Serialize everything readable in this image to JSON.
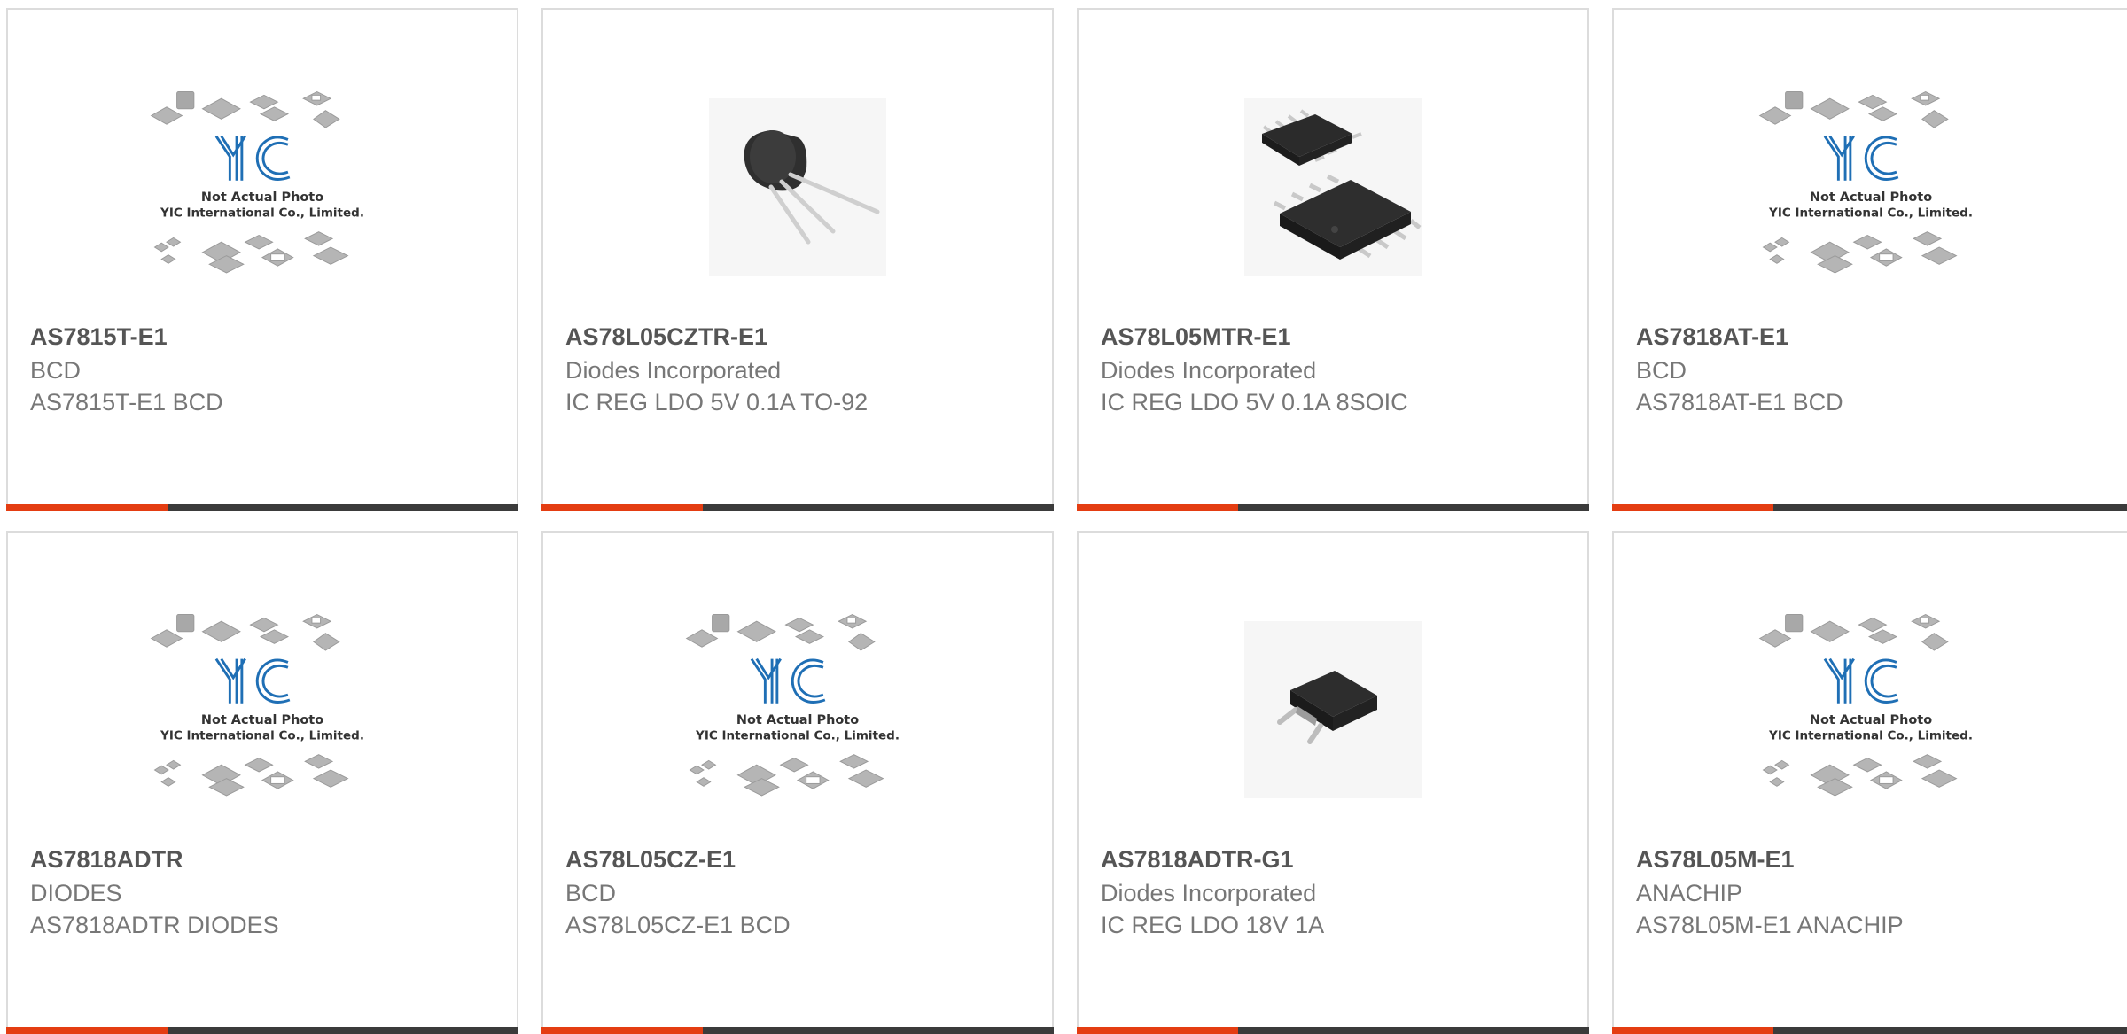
{
  "placeholder": {
    "line1": "Not Actual Photo",
    "line2": "YIC International Co., Limited.",
    "logo_text": "YIC",
    "logo_color": "#1f6fb5"
  },
  "colors": {
    "accent": "#e43d12",
    "bar": "#3b3b3b",
    "border": "#dcdcdc"
  },
  "products": [
    {
      "part": "AS7815T-E1",
      "manufacturer": "BCD",
      "description": "AS7815T-E1 BCD",
      "image": "placeholder-logo"
    },
    {
      "part": "AS78L05CZTR-E1",
      "manufacturer": "Diodes Incorporated",
      "description": "IC REG LDO 5V 0.1A TO-92",
      "image": "to92-package"
    },
    {
      "part": "AS78L05MTR-E1",
      "manufacturer": "Diodes Incorporated",
      "description": "IC REG LDO 5V 0.1A 8SOIC",
      "image": "soic8-package"
    },
    {
      "part": "AS7818AT-E1",
      "manufacturer": "BCD",
      "description": "AS7818AT-E1 BCD",
      "image": "placeholder-logo"
    },
    {
      "part": "AS7818ADTR",
      "manufacturer": "DIODES",
      "description": "AS7818ADTR DIODES",
      "image": "placeholder-logo"
    },
    {
      "part": "AS78L05CZ-E1",
      "manufacturer": "BCD",
      "description": "AS78L05CZ-E1 BCD",
      "image": "placeholder-logo"
    },
    {
      "part": "AS7818ADTR-G1",
      "manufacturer": "Diodes Incorporated",
      "description": "IC REG LDO 18V 1A",
      "image": "dpak-package"
    },
    {
      "part": "AS78L05M-E1",
      "manufacturer": "ANACHIP",
      "description": "AS78L05M-E1 ANACHIP",
      "image": "placeholder-logo"
    }
  ]
}
